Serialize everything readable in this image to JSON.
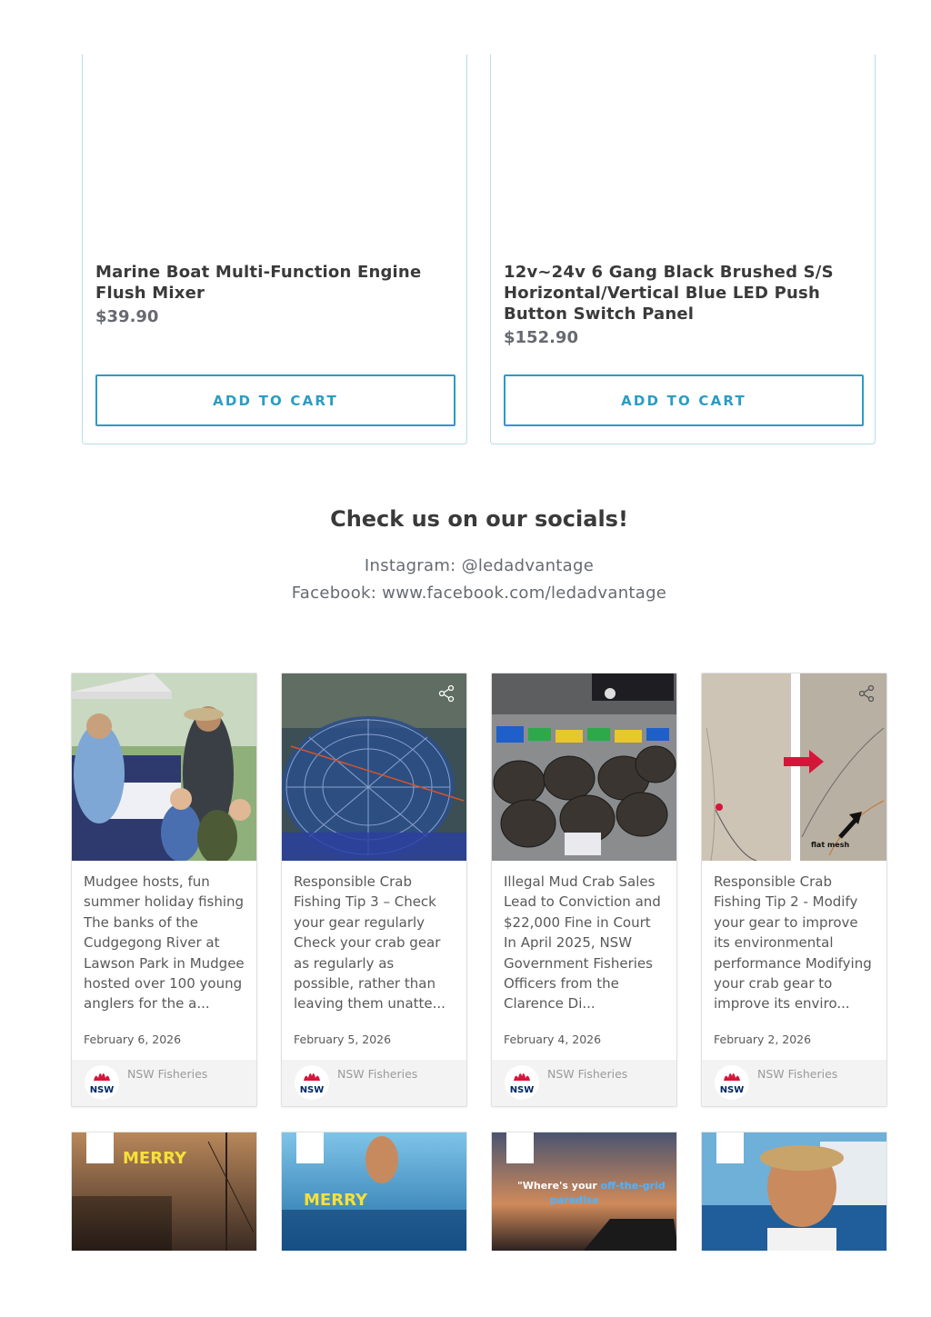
{
  "products": [
    {
      "title": "Marine Boat Multi-Function Engine Flush Mixer",
      "price": "$39.90",
      "button": "ADD TO CART"
    },
    {
      "title": "12v~24v 6 Gang Black Brushed S/S Horizontal/Vertical Blue LED Push Button Switch Panel",
      "price": "$152.90",
      "button": "ADD TO CART"
    }
  ],
  "socials": {
    "heading": "Check us on our socials!",
    "instagram_label": "Instagram: ",
    "instagram_handle": "@ledadvantage",
    "facebook_label": "Facebook: ",
    "facebook_url": "www.facebook.com/ledadvantage"
  },
  "feed": [
    {
      "text": "Mudgee hosts, fun summer holiday fishing The banks of the Cudgegong River at Lawson Park in Mudgee hosted over 100 young anglers for the a...",
      "date": "February 6, 2026",
      "author": "NSW Fisheries",
      "avatar_text": "NSW"
    },
    {
      "text": "Responsible Crab Fishing Tip 3 – Check your gear regularly Check your crab gear as regularly as possible, rather than leaving them unatte...",
      "date": "February 5, 2026",
      "author": "NSW Fisheries",
      "avatar_text": "NSW"
    },
    {
      "text": "Illegal Mud Crab Sales Lead to Conviction and $22,000 Fine in Court In April 2025, NSW Government Fisheries Officers from the Clarence Di...",
      "date": "February 4, 2026",
      "author": "NSW Fisheries",
      "avatar_text": "NSW"
    },
    {
      "text": "Responsible Crab Fishing Tip 2 - Modify your gear to improve its environmental performance Modifying your crab gear to improve its enviro...",
      "date": "February 2, 2026",
      "author": "NSW Fisheries",
      "avatar_text": "NSW",
      "image_caption": "flat mesh"
    }
  ],
  "feed_row2": [
    {
      "overlay": "MERRY"
    },
    {
      "overlay": "MERRY"
    },
    {
      "overlay_1": "\"Where's your ",
      "overlay_2": "off-the-grid",
      "overlay_3": "paradise"
    },
    {}
  ],
  "colors": {
    "accent": "#2b9cc4",
    "card_border": "#b9dcea",
    "nsw_red": "#d7153a",
    "nsw_navy": "#002664"
  }
}
